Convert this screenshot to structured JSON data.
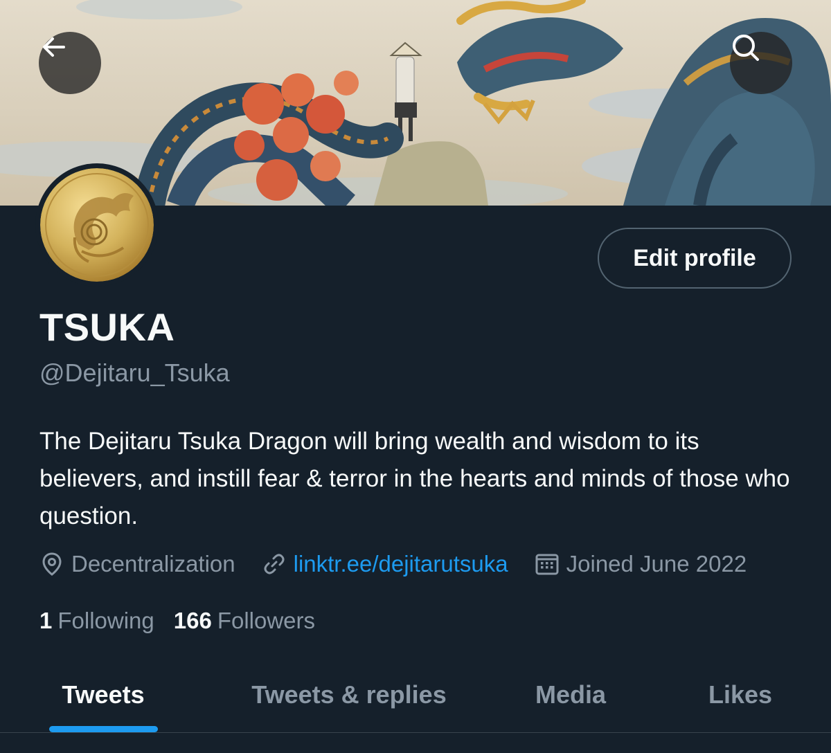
{
  "header": {
    "back_icon": "arrow-left-icon",
    "search_icon": "search-icon"
  },
  "profile": {
    "display_name": "TSUKA",
    "handle": "@Dejitaru_Tsuka",
    "bio": "The Dejitaru Tsuka Dragon will bring wealth and wisdom to its believers, and instill fear & terror in the hearts and minds of those who question.",
    "edit_profile_label": "Edit profile",
    "location": "Decentralization",
    "website": "linktr.ee/dejitarutsuka",
    "joined": "Joined June 2022",
    "following_count": "1",
    "following_label": "Following",
    "followers_count": "166",
    "followers_label": "Followers"
  },
  "tabs": [
    {
      "label": "Tweets",
      "active": true
    },
    {
      "label": "Tweets & replies",
      "active": false
    },
    {
      "label": "Media",
      "active": false
    },
    {
      "label": "Likes",
      "active": false
    }
  ],
  "colors": {
    "background": "#15202b",
    "accent": "#1d9bf0",
    "secondary_text": "#8b98a5",
    "primary_text": "#f7f9f9"
  }
}
